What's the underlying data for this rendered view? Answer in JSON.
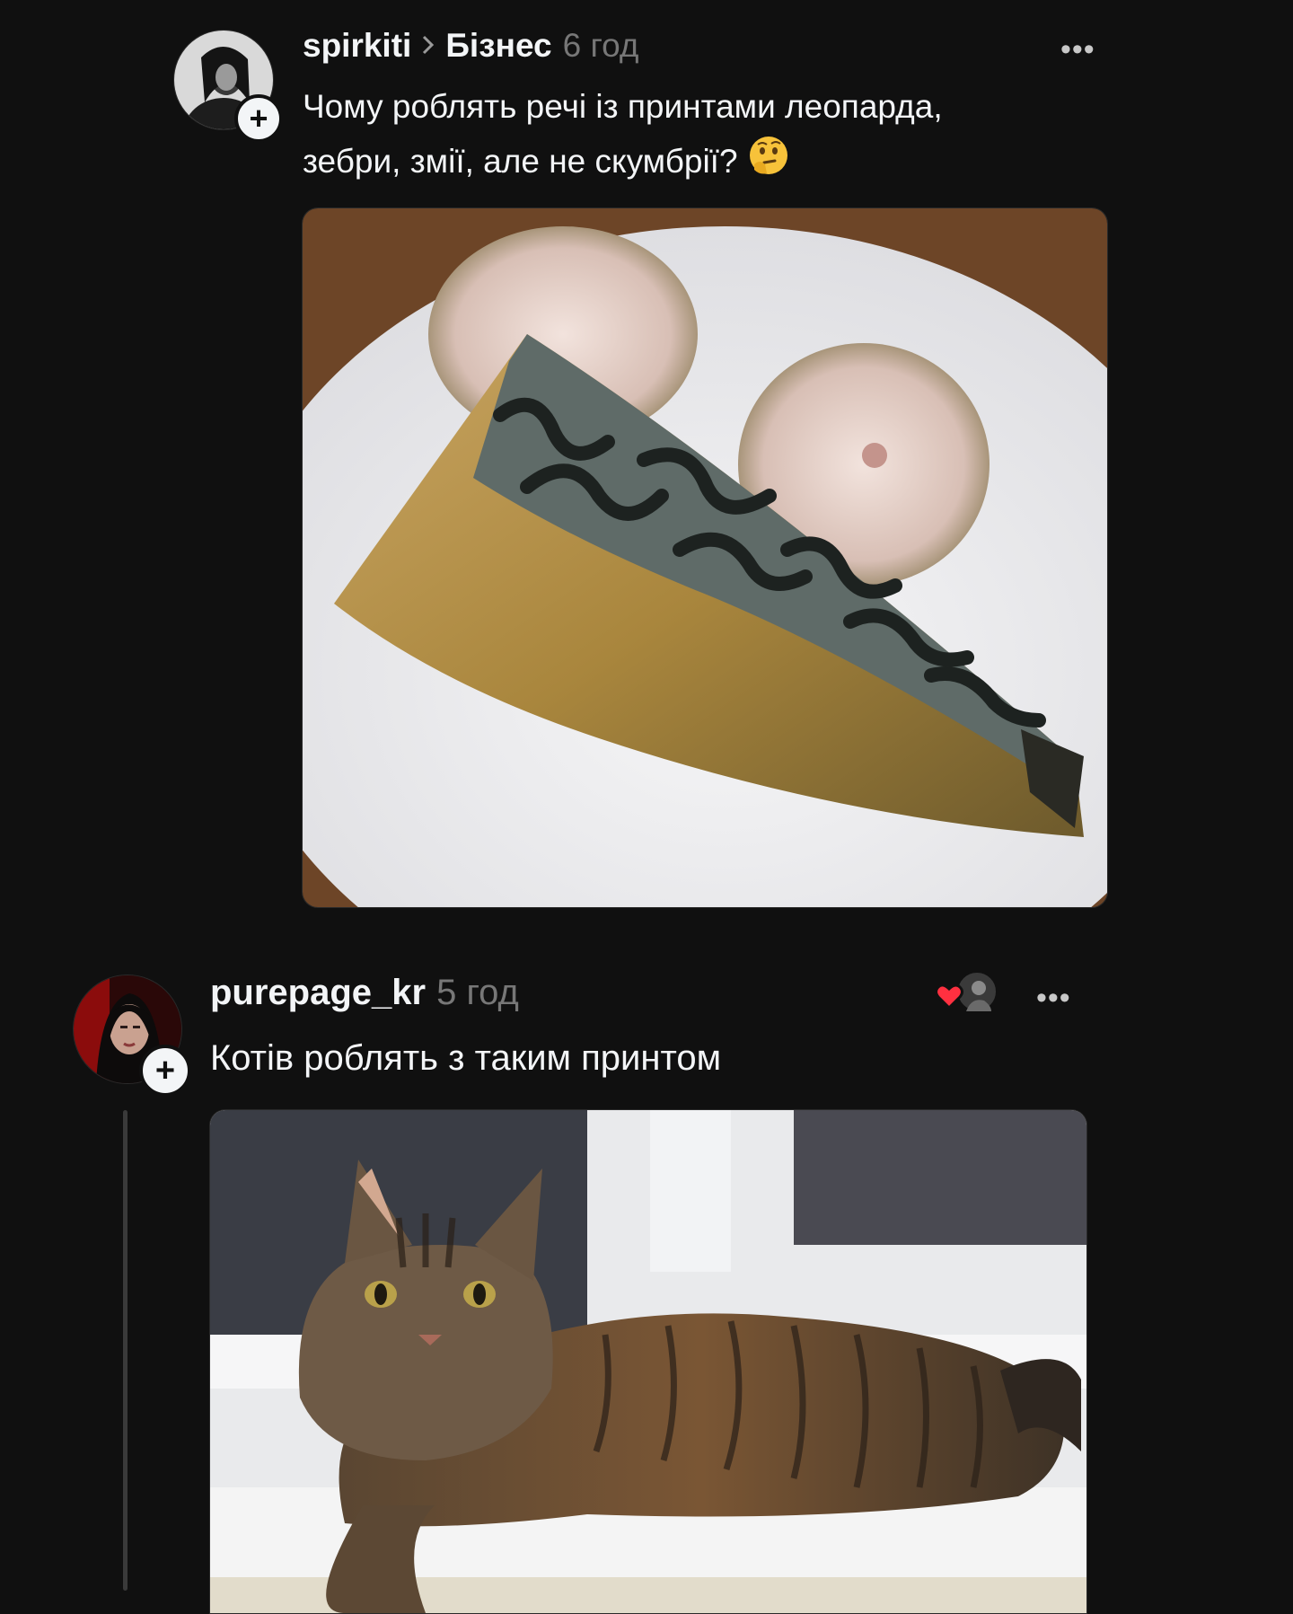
{
  "post1": {
    "username": "spirkiti",
    "topic": "Бізнес",
    "time": "6 год",
    "text_line1": "Чому роблять речі із принтами леопарда,",
    "text_line2": "зебри, змії, але не скумбрії?",
    "emoji": "thinking-face-icon",
    "more": "•••",
    "follow": "+"
  },
  "reply": {
    "username": "purepage_kr",
    "time": "5 год",
    "text": "Котів роблять з таким принтом",
    "more": "•••",
    "follow": "+",
    "liked_by_author": true
  },
  "colors": {
    "background": "#101010",
    "text": "#f3f5f7",
    "muted": "#777777",
    "like": "#ff3040"
  }
}
